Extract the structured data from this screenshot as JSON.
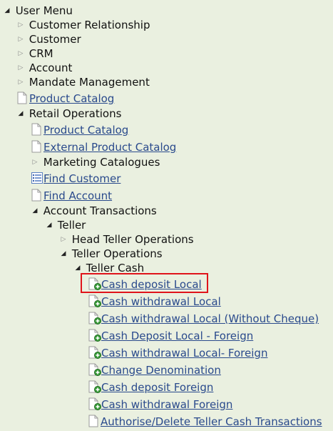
{
  "menu": {
    "root": "User Menu",
    "items": [
      "Customer Relationship",
      "Customer",
      "CRM",
      "Account",
      "Mandate Management"
    ],
    "product_catalog_top": "Product Catalog",
    "retail_operations": "Retail Operations",
    "retail": {
      "product_catalog": "Product Catalog",
      "external_product_catalog": "External Product Catalog",
      "marketing_catalogues": "Marketing Catalogues",
      "find_customer": "Find Customer",
      "find_account": "Find Account",
      "account_transactions": "Account Transactions",
      "teller": "Teller",
      "head_teller_operations": "Head Teller Operations",
      "teller_operations": "Teller Operations",
      "teller_cash": "Teller Cash",
      "teller_cash_items": [
        "Cash deposit Local",
        "Cash withdrawal Local",
        "Cash withdrawal Local (Without Cheque)",
        "Cash Deposit Local - Foreign",
        "Cash withdrawal Local- Foreign",
        "Change Denomination",
        "Cash deposit Foreign",
        "Cash withdrawal Foreign",
        "Authorise/Delete Teller Cash Transactions"
      ]
    }
  },
  "colors": {
    "link": "#2a4a8c",
    "highlight": "#e0141b",
    "background": "#eaf0e0"
  },
  "icons": {
    "expanded": "triangle-down-icon",
    "collapsed": "triangle-right-icon",
    "document": "document-icon",
    "document_plus": "document-plus-icon",
    "list": "list-icon"
  }
}
